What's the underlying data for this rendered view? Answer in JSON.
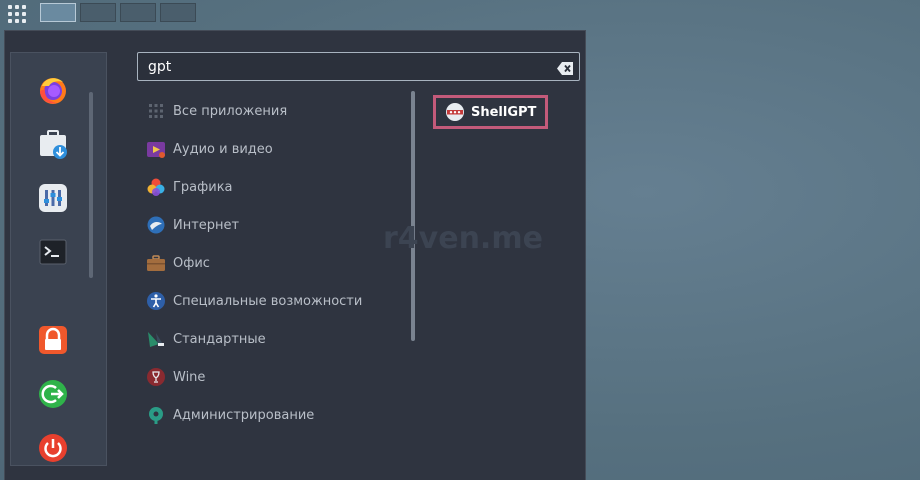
{
  "topbar": {
    "apps_icon": "app-grid-icon",
    "workspaces": [
      {
        "active": true
      },
      {
        "active": false
      },
      {
        "active": false
      },
      {
        "active": false
      }
    ]
  },
  "favorites": [
    {
      "name": "firefox-icon"
    },
    {
      "name": "software-install-icon"
    },
    {
      "name": "settings-sliders-icon"
    },
    {
      "name": "terminal-icon"
    },
    {
      "name": "lock-icon"
    },
    {
      "name": "logout-icon"
    },
    {
      "name": "power-icon"
    }
  ],
  "search": {
    "value": "gpt",
    "clear_icon": "backspace-clear-icon"
  },
  "categories": [
    {
      "label": "Все приложения"
    },
    {
      "label": "Аудио и видео"
    },
    {
      "label": "Графика"
    },
    {
      "label": "Интернет"
    },
    {
      "label": "Офис"
    },
    {
      "label": "Специальные возможности"
    },
    {
      "label": "Стандартные"
    },
    {
      "label": "Wine"
    },
    {
      "label": "Администрирование"
    }
  ],
  "results": [
    {
      "label": "ShellGPT"
    }
  ],
  "watermark": "r4ven.me",
  "colors": {
    "menu_bg": "#2f3440",
    "highlight_border": "#c35a7a",
    "desktop_bg": "#5b7688"
  }
}
